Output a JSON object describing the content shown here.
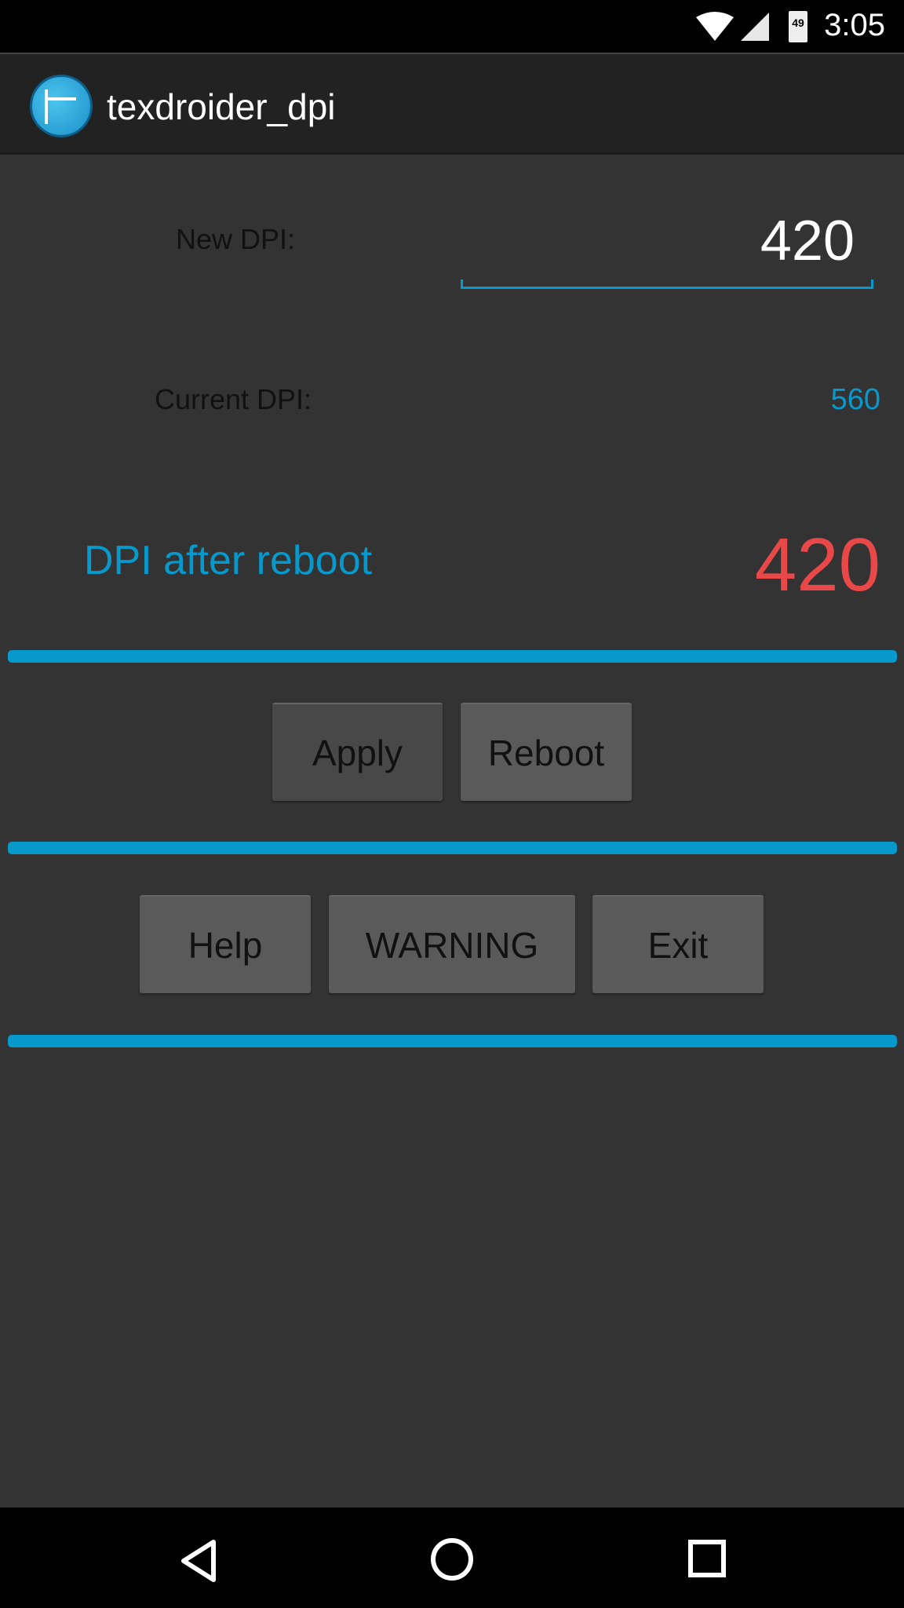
{
  "status_bar": {
    "time": "3:05",
    "battery": "49",
    "icons": [
      "wifi-icon",
      "cell-signal-icon",
      "battery-icon"
    ]
  },
  "action_bar": {
    "title": "texdroider_dpi",
    "icon": "app-logo-icon"
  },
  "new_dpi": {
    "label": "New DPI:",
    "value": "420"
  },
  "current_dpi": {
    "label": "Current DPI:",
    "value": "560"
  },
  "after_reboot": {
    "label": "DPI after reboot",
    "value": "420"
  },
  "buttons": {
    "apply": "Apply",
    "reboot": "Reboot",
    "help": "Help",
    "warning": "WARNING",
    "exit": "Exit"
  },
  "colors": {
    "accent": "#0899cc",
    "value_red": "#e84848",
    "background": "#333333"
  },
  "nav": {
    "icons": [
      "back-icon",
      "home-icon",
      "recents-icon"
    ]
  }
}
